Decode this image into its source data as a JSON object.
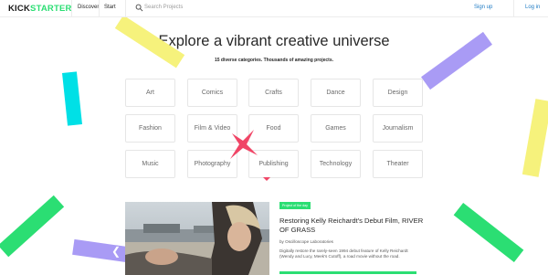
{
  "header": {
    "logo_part1": "KICK",
    "logo_part2": "STARTER",
    "nav_discover": "Discover",
    "nav_start": "Start",
    "search_placeholder": "Search Projects",
    "signup": "Sign up",
    "login": "Log in"
  },
  "hero": {
    "title": "Explore a vibrant creative universe",
    "subtitle": "15 diverse categories. Thousands of amazing projects."
  },
  "categories": [
    {
      "label": "Art"
    },
    {
      "label": "Comics"
    },
    {
      "label": "Crafts"
    },
    {
      "label": "Dance"
    },
    {
      "label": "Design"
    },
    {
      "label": "Fashion"
    },
    {
      "label": "Film & Video"
    },
    {
      "label": "Food"
    },
    {
      "label": "Games"
    },
    {
      "label": "Journalism"
    },
    {
      "label": "Music"
    },
    {
      "label": "Photography"
    },
    {
      "label": "Publishing"
    },
    {
      "label": "Technology"
    },
    {
      "label": "Theater"
    }
  ],
  "featured": {
    "badge": "Project of the day",
    "title": "Restoring Kelly Reichardt's Debut Film, RIVER OF GRASS",
    "creator": "by Oscilloscope Laboratories",
    "description": "Digitally restore the rarely-seen 1994 debut feature of Kelly Reichardt (Wendy and Lucy, Meek's Cutoff), a road movie without the road.",
    "funded_fraction": 1.0
  },
  "colors": {
    "brand_green": "#2bde73",
    "confetti_yellow": "#f6f27c",
    "confetti_cyan": "#00e0e6",
    "confetti_purple": "#a99bf5",
    "confetti_green": "#2bde73",
    "confetti_red": "#f04566",
    "link_blue": "#1f7bc4"
  }
}
